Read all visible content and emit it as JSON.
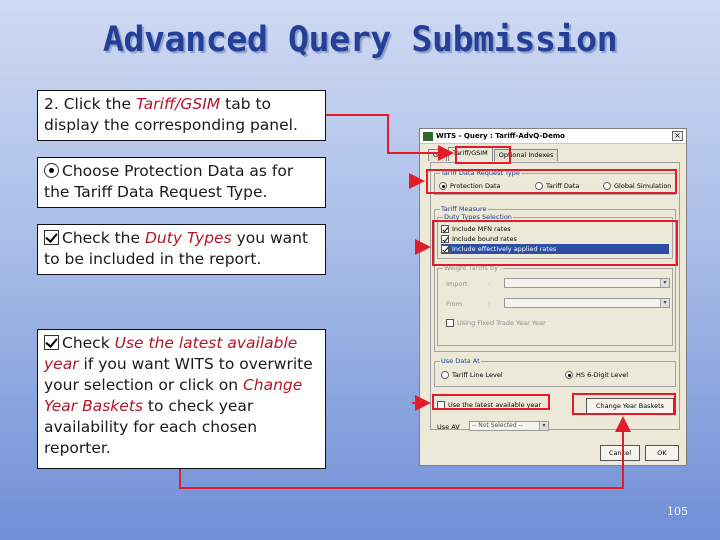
{
  "slide_title": "Advanced Query Submission",
  "page_number": "105",
  "callouts": {
    "tab": {
      "prefix": "2. Click the ",
      "emph": "Tariff/GSIM",
      "suffix": " tab to display the corresponding panel."
    },
    "protection": {
      "text": "Choose Protection Data as for the Tariff Data Request Type."
    },
    "duty": {
      "prefix": "Check the ",
      "emph": "Duty Types",
      "suffix": " you want to be included in the report."
    },
    "latest": {
      "prefix": "Check ",
      "emph1": "Use the latest available year",
      "middle": " if you want WITS to overwrite your selection or click on ",
      "emph2": "Change Year Baskets",
      "suffix": " to check year availability for each chosen reporter."
    }
  },
  "dialog": {
    "title": "WITS - Query : Tariff-AdvQ-Demo",
    "close_label": "×",
    "tabs": [
      "Ge",
      "Tariff/GSIM",
      "Optional Indexes"
    ],
    "request_type": {
      "label": "Tariff Data Request Type",
      "options": [
        "Protection Data",
        "Tariff Data",
        "Global Simulation"
      ],
      "selected": "Protection Data"
    },
    "tariff_measure": {
      "label": "Tariff Measure",
      "duty_label": "Duty Types Selection",
      "duties": [
        "Include MFN rates",
        "Include bound rates",
        "Include effectively applied rates"
      ],
      "weight_label": "Weight Tariffs by :",
      "import_label": "Import",
      "from_label": "From",
      "fixed_year_label": "Using Fixed Trade Year Year"
    },
    "use_data_at": {
      "label": "Use Data At",
      "options": [
        "Tariff Line Level",
        "HS 6-Digit Level"
      ],
      "selected": "HS 6-Digit Level"
    },
    "latest_year_label": "Use the latest available year",
    "change_year_label": "Change Year Baskets",
    "use_av_label": "Use AV",
    "use_av_value": "-- Not Selected --",
    "cancel_label": "Cancel",
    "ok_label": "OK"
  }
}
